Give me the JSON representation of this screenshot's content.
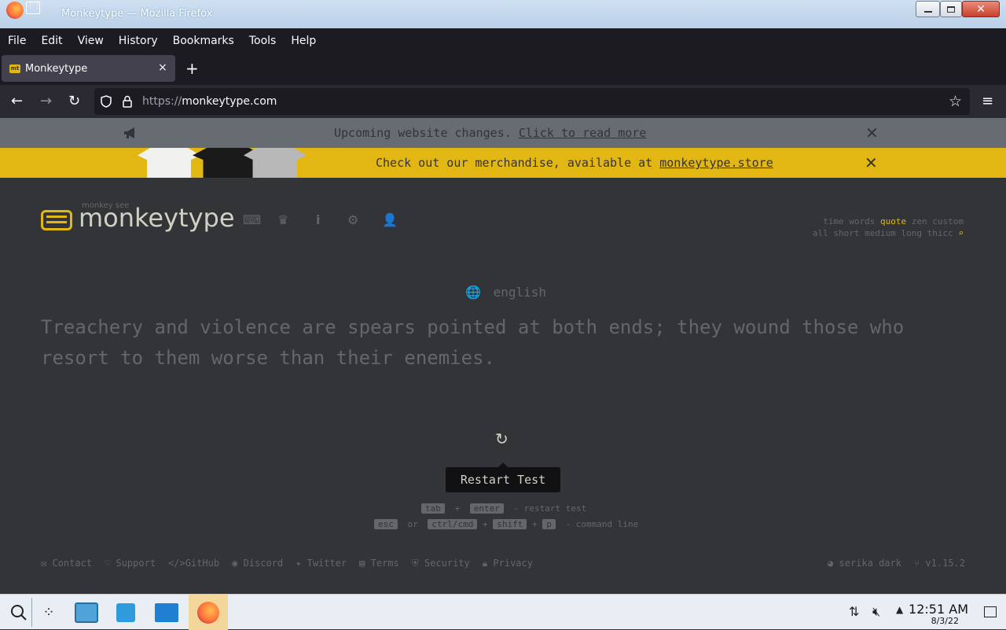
{
  "window": {
    "title": "Monkeytype — Mozilla Firefox"
  },
  "menubar": [
    "File",
    "Edit",
    "View",
    "History",
    "Bookmarks",
    "Tools",
    "Help"
  ],
  "tab": {
    "favicon_text": "mt",
    "title": "Monkeytype",
    "close": "×",
    "new_tab": "+"
  },
  "navbar": {
    "url_scheme": "https://",
    "url_host": "monkeytype.com"
  },
  "banners": {
    "announcement": {
      "text": "Upcoming website changes. ",
      "link": "Click to read more",
      "close": "✕"
    },
    "merch": {
      "text": "Check out our merchandise, available at ",
      "link": "monkeytype.store",
      "close": "✕"
    }
  },
  "logo": {
    "subtitle": "monkey see",
    "text": "monkeytype"
  },
  "config": {
    "row1": [
      "time",
      "words",
      "quote",
      "zen",
      "custom"
    ],
    "row1_active": "quote",
    "row2": [
      "all",
      "short",
      "medium",
      "long",
      "thicc"
    ]
  },
  "test": {
    "language": "english",
    "words": "Treachery and violence are spears pointed at both ends; they wound those who resort to them worse than their enemies."
  },
  "restart": {
    "tooltip": "Restart Test"
  },
  "hints": {
    "line1": {
      "key1": "tab",
      "plus": "+",
      "key2": "enter",
      "desc": "- restart test"
    },
    "line2": {
      "key1": "esc",
      "or": "or",
      "key2": "ctrl/cmd",
      "plus1": "+",
      "key3": "shift",
      "plus2": "+",
      "key4": "p",
      "desc": "- command line"
    }
  },
  "footer": {
    "left": [
      "Contact",
      "Support",
      "GitHub",
      "Discord",
      "Twitter",
      "Terms",
      "Security",
      "Privacy"
    ],
    "theme": "serika dark",
    "version": "v1.15.2"
  },
  "taskbar": {
    "time": "12:51 AM",
    "date": "8/3/22"
  },
  "colors": {
    "bg": "#323437",
    "main": "#e2b714",
    "sub": "#646669",
    "text": "#d1d0c5"
  }
}
